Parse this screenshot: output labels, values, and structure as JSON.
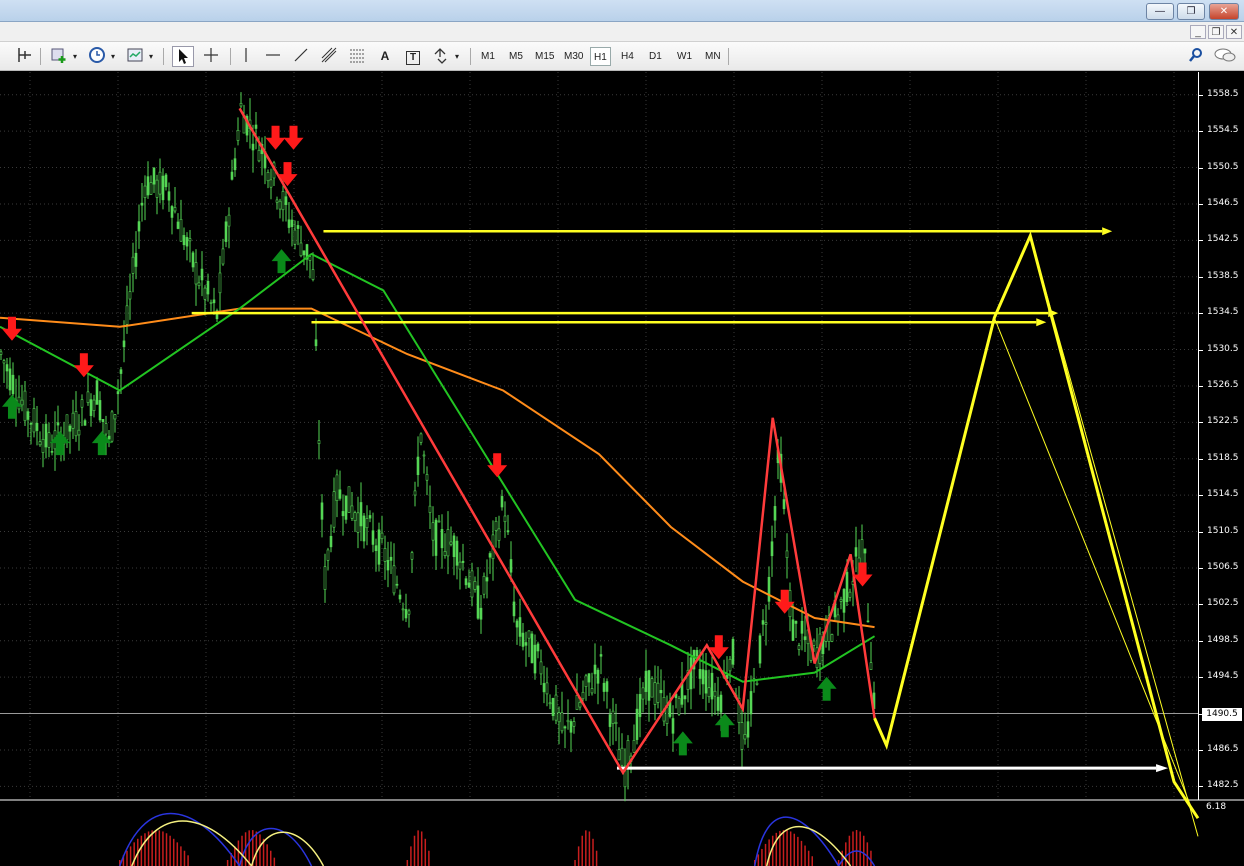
{
  "window": {
    "minimize_glyph": "—",
    "restore_glyph": "❐",
    "close_glyph": "✕",
    "mdi_minimize_glyph": "_",
    "mdi_restore_glyph": "❐",
    "mdi_close_glyph": "✕"
  },
  "toolbar": {
    "timeframes": [
      "M1",
      "M5",
      "M15",
      "M30",
      "H1",
      "H4",
      "D1",
      "W1",
      "MN"
    ],
    "active_timeframe": "H1",
    "text_tool_label": "A",
    "label_tool_label": "T"
  },
  "price_axis": {
    "ticks": [
      "1558.5",
      "1554.5",
      "1550.5",
      "1546.5",
      "1542.5",
      "1538.5",
      "1534.5",
      "1530.5",
      "1526.5",
      "1522.5",
      "1518.5",
      "1514.5",
      "1510.5",
      "1506.5",
      "1502.5",
      "1498.5",
      "1494.5",
      "1490.5",
      "1486.5",
      "1482.5"
    ],
    "current_price": "1490.5",
    "oscillator_label": "6.18"
  },
  "colors": {
    "candles": "#55d655",
    "ma_fast": "#22c422",
    "ma_slow": "#ff8c1a",
    "zigzag": "#ff3b3b",
    "projection": "#ffff22",
    "target": "#ffffff",
    "buy_arrow": "#0a8a1a",
    "sell_arrow": "#ff1a1a",
    "grid": "#3a3a3a"
  },
  "chart_data": {
    "type": "line",
    "title": "",
    "ylim": [
      1481,
      1561
    ],
    "price_path": [
      [
        0,
        1530
      ],
      [
        0.02,
        1524
      ],
      [
        0.04,
        1520
      ],
      [
        0.06,
        1522
      ],
      [
        0.08,
        1526
      ],
      [
        0.09,
        1520
      ],
      [
        0.1,
        1528
      ],
      [
        0.12,
        1549
      ],
      [
        0.14,
        1548
      ],
      [
        0.16,
        1540
      ],
      [
        0.18,
        1534
      ],
      [
        0.2,
        1557
      ],
      [
        0.22,
        1552
      ],
      [
        0.24,
        1545
      ],
      [
        0.26,
        1540
      ],
      [
        0.27,
        1505
      ],
      [
        0.28,
        1515
      ],
      [
        0.3,
        1512
      ],
      [
        0.32,
        1508
      ],
      [
        0.34,
        1502
      ],
      [
        0.35,
        1522
      ],
      [
        0.36,
        1510
      ],
      [
        0.38,
        1509
      ],
      [
        0.4,
        1502
      ],
      [
        0.42,
        1514
      ],
      [
        0.43,
        1500
      ],
      [
        0.45,
        1496
      ],
      [
        0.47,
        1488
      ],
      [
        0.5,
        1496
      ],
      [
        0.52,
        1484
      ],
      [
        0.54,
        1494
      ],
      [
        0.56,
        1490
      ],
      [
        0.58,
        1496
      ],
      [
        0.6,
        1492
      ],
      [
        0.61,
        1498
      ],
      [
        0.62,
        1486
      ],
      [
        0.64,
        1503
      ],
      [
        0.65,
        1520
      ],
      [
        0.66,
        1500
      ],
      [
        0.68,
        1497
      ],
      [
        0.7,
        1502
      ],
      [
        0.72,
        1509
      ],
      [
        0.73,
        1490
      ]
    ],
    "ma_fast": [
      [
        0,
        1533
      ],
      [
        0.1,
        1526
      ],
      [
        0.2,
        1535
      ],
      [
        0.26,
        1541
      ],
      [
        0.32,
        1537
      ],
      [
        0.4,
        1520
      ],
      [
        0.48,
        1503
      ],
      [
        0.56,
        1498
      ],
      [
        0.62,
        1494
      ],
      [
        0.68,
        1495
      ],
      [
        0.73,
        1499
      ]
    ],
    "ma_slow": [
      [
        0,
        1534
      ],
      [
        0.1,
        1533
      ],
      [
        0.2,
        1535
      ],
      [
        0.26,
        1535
      ],
      [
        0.34,
        1530
      ],
      [
        0.42,
        1526
      ],
      [
        0.5,
        1519
      ],
      [
        0.56,
        1511
      ],
      [
        0.62,
        1505
      ],
      [
        0.68,
        1501
      ],
      [
        0.73,
        1500
      ]
    ],
    "zigzag": [
      [
        0.2,
        1557
      ],
      [
        0.52,
        1484
      ],
      [
        0.59,
        1498
      ],
      [
        0.62,
        1491
      ],
      [
        0.645,
        1523
      ],
      [
        0.68,
        1496
      ],
      [
        0.71,
        1508
      ],
      [
        0.73,
        1490
      ]
    ],
    "projection": [
      [
        0.73,
        1490
      ],
      [
        0.74,
        1487
      ],
      [
        0.83,
        1534
      ],
      [
        0.86,
        1543
      ],
      [
        0.98,
        1483
      ],
      [
        1.0,
        1479
      ]
    ],
    "buy_signals": [
      [
        0.01,
        1524
      ],
      [
        0.05,
        1520
      ],
      [
        0.085,
        1520
      ],
      [
        0.235,
        1540
      ],
      [
        0.57,
        1487
      ],
      [
        0.605,
        1489
      ],
      [
        0.69,
        1493
      ]
    ],
    "sell_signals": [
      [
        0.01,
        1533
      ],
      [
        0.07,
        1529
      ],
      [
        0.23,
        1554
      ],
      [
        0.24,
        1550
      ],
      [
        0.245,
        1554
      ],
      [
        0.415,
        1518
      ],
      [
        0.6,
        1498
      ],
      [
        0.655,
        1503
      ],
      [
        0.72,
        1506
      ]
    ],
    "horizontal_levels": [
      1543.5,
      1534.5,
      1533.5
    ],
    "target_level": 1484.5
  }
}
